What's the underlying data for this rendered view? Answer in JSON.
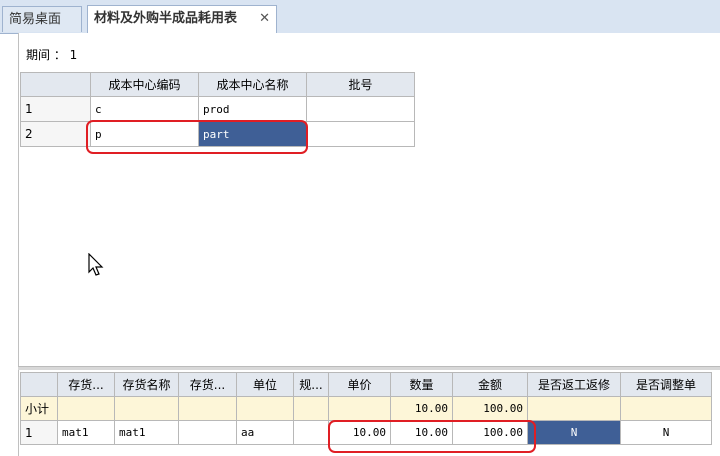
{
  "tabs": [
    {
      "label": "简易桌面"
    },
    {
      "label": "材料及外购半成品耗用表",
      "close": "✕"
    }
  ],
  "period": {
    "label": "期间 ： 1"
  },
  "grid_top": {
    "headers": [
      "",
      "成本中心编码",
      "成本中心名称",
      "批号"
    ],
    "rows": [
      {
        "no": "1",
        "code": "c",
        "name": "prod",
        "batch": ""
      },
      {
        "no": "2",
        "code": "p",
        "name": "part",
        "batch": ""
      }
    ]
  },
  "grid_bottom": {
    "headers": [
      "",
      "存货...",
      "存货名称",
      "存货...",
      "单位",
      "规...",
      "单价",
      "数量",
      "金额",
      "是否返工返修",
      "是否调整单"
    ],
    "subtotal": {
      "label": "小计",
      "qty": "10.00",
      "amount": "100.00"
    },
    "rows": [
      {
        "no": "1",
        "code": "mat1",
        "name": "mat1",
        "spec": "",
        "unit": "aa",
        "model": "",
        "price": "10.00",
        "qty": "10.00",
        "amount": "100.00",
        "rework": "N",
        "adjust": "N"
      }
    ]
  },
  "colors": {
    "selected": "#3f5f96",
    "highlight": "#e01e24",
    "header": "#e3e8ef"
  }
}
